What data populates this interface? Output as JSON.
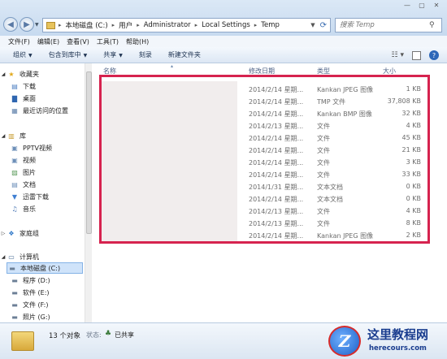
{
  "address": {
    "crumbs": [
      "本地磁盘 (C:)",
      "用户",
      "Administrator",
      "Local Settings",
      "Temp"
    ]
  },
  "search": {
    "placeholder": "搜索 Temp"
  },
  "menu": [
    "文件(F)",
    "编辑(E)",
    "查看(V)",
    "工具(T)",
    "帮助(H)"
  ],
  "commands": {
    "organize": "组织",
    "include": "包含到库中",
    "share": "共享",
    "burn": "刻录",
    "new_folder": "新建文件夹"
  },
  "nav": {
    "favorites": "收藏夹",
    "downloads": "下载",
    "desktop": "桌面",
    "recent": "最近访问的位置",
    "libraries": "库",
    "pptv": "PPTV视频",
    "videos": "视频",
    "pictures": "图片",
    "documents": "文档",
    "thunder": "迅雷下载",
    "music": "音乐",
    "homegroup": "家庭组",
    "computer": "计算机",
    "drive_c": "本地磁盘 (C:)",
    "drive_d": "程序 (D:)",
    "drive_e": "软件 (E:)",
    "drive_f": "文件 (F:)",
    "drive_g": "照片 (G:)"
  },
  "columns": {
    "name": "名称",
    "date": "修改日期",
    "type": "类型",
    "size": "大小"
  },
  "files": [
    {
      "date": "2014/2/14 星期...",
      "type": "Kankan JPEG 图像",
      "size": "1 KB"
    },
    {
      "date": "2014/2/14 星期...",
      "type": "TMP 文件",
      "size": "37,808 KB"
    },
    {
      "date": "2014/2/14 星期...",
      "type": "Kankan BMP 图像",
      "size": "32 KB"
    },
    {
      "date": "2014/2/13 星期...",
      "type": "文件",
      "size": "4 KB"
    },
    {
      "date": "2014/2/14 星期...",
      "type": "文件",
      "size": "45 KB"
    },
    {
      "date": "2014/2/14 星期...",
      "type": "文件",
      "size": "21 KB"
    },
    {
      "date": "2014/2/14 星期...",
      "type": "文件",
      "size": "3 KB"
    },
    {
      "date": "2014/2/14 星期...",
      "type": "文件",
      "size": "33 KB"
    },
    {
      "date": "2014/1/31 星期...",
      "type": "文本文档",
      "size": "0 KB"
    },
    {
      "date": "2014/2/14 星期...",
      "type": "文本文档",
      "size": "0 KB"
    },
    {
      "date": "2014/2/13 星期...",
      "type": "文件",
      "size": "4 KB"
    },
    {
      "date": "2014/2/13 星期...",
      "type": "文件",
      "size": "8 KB"
    },
    {
      "date": "2014/2/14 星期...",
      "type": "Kankan JPEG 图像",
      "size": "2 KB"
    }
  ],
  "status": {
    "count": "13 个对象",
    "state_label": "状态:",
    "state_value": "已共享"
  },
  "watermark": {
    "title": "这里教程网",
    "url": "herecours.com",
    "logo_letter": "Z"
  },
  "colors": {
    "highlight": "#d6234f",
    "selection": "#cfe3fa"
  }
}
